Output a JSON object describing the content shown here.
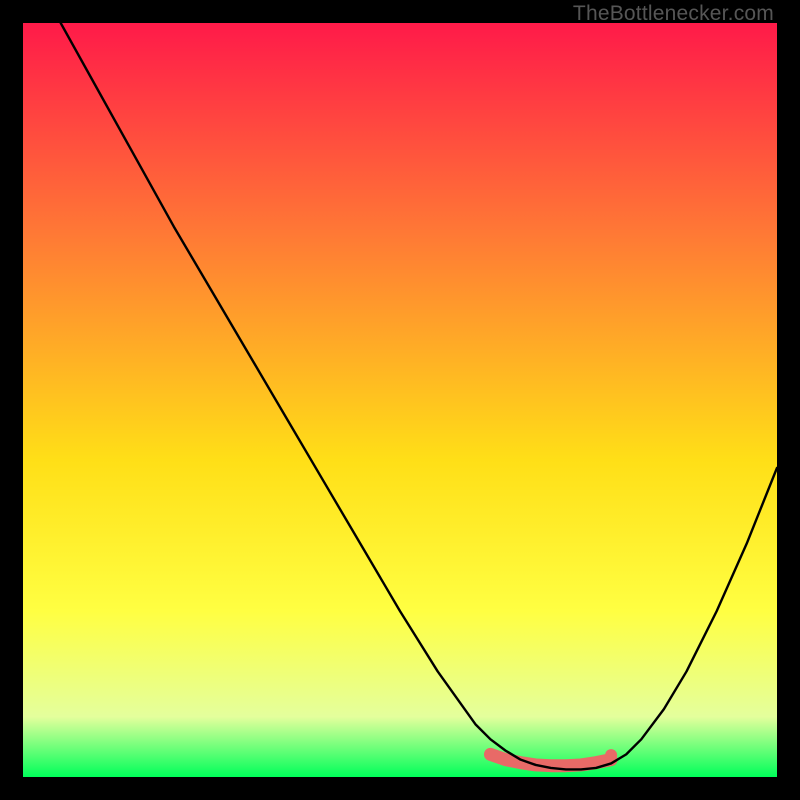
{
  "watermark": "TheBottlenecker.com",
  "chart_data": {
    "type": "line",
    "title": "",
    "xlabel": "",
    "ylabel": "",
    "xlim": [
      0,
      100
    ],
    "ylim": [
      0,
      100
    ],
    "grid": false,
    "gradient": {
      "top": "#ff1a49",
      "upper_mid": "#ff7935",
      "mid": "#ffdf17",
      "lower_mid": "#ffff42",
      "near_bottom": "#e4ff9c",
      "bottom": "#00ff5a"
    },
    "series": [
      {
        "name": "curve",
        "color": "#000000",
        "x": [
          5,
          10,
          15,
          20,
          25,
          30,
          35,
          40,
          45,
          50,
          55,
          60,
          62,
          64,
          66,
          68,
          70,
          72,
          74,
          76,
          78,
          80,
          82,
          85,
          88,
          92,
          96,
          100
        ],
        "y": [
          100,
          91,
          82,
          73,
          64.5,
          56,
          47.5,
          39,
          30.5,
          22,
          14,
          7,
          5,
          3.5,
          2.3,
          1.6,
          1.2,
          1.0,
          1.0,
          1.2,
          1.8,
          3,
          5,
          9,
          14,
          22,
          31,
          41
        ]
      },
      {
        "name": "flat-marker",
        "color": "#e86a67",
        "style": "thick-rounded",
        "x": [
          62,
          64,
          66,
          68,
          70,
          72,
          74,
          76,
          78
        ],
        "y": [
          3.0,
          2.3,
          1.9,
          1.6,
          1.5,
          1.5,
          1.6,
          1.9,
          2.3
        ]
      }
    ],
    "dot": {
      "x": 78,
      "y": 2.9,
      "color": "#e86a67",
      "r": 6
    }
  }
}
